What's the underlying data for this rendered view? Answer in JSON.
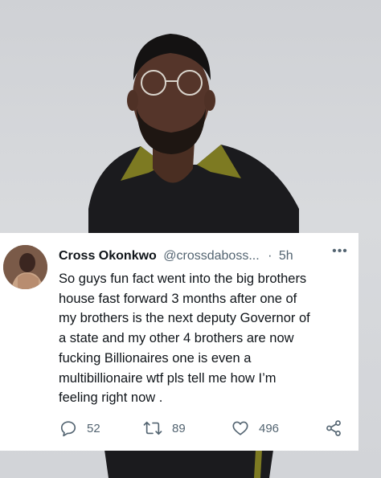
{
  "tweet": {
    "display_name": "Cross Okonkwo",
    "handle": "@crossdaboss...",
    "separator": "·",
    "time": "5h",
    "more": "•••",
    "text_lines": [
      "So guys fun fact went into the big brothers",
      "house fast forward 3 months after one of",
      "my brothers is the next deputy Governor of",
      "a state and my other 4 brothers are now",
      "fucking Billionaires one is even a",
      "multibillionaire wtf pls tell me how I’m",
      "feeling right now ."
    ],
    "actions": {
      "reply_count": "52",
      "retweet_count": "89",
      "like_count": "496"
    }
  },
  "icons": {
    "reply": "reply-icon",
    "retweet": "retweet-icon",
    "like": "heart-icon",
    "share": "share-icon",
    "more": "more-icon"
  },
  "colors": {
    "text": "#0f1419",
    "muted": "#536471",
    "card": "#ffffff",
    "background": "#d3d5d9"
  }
}
